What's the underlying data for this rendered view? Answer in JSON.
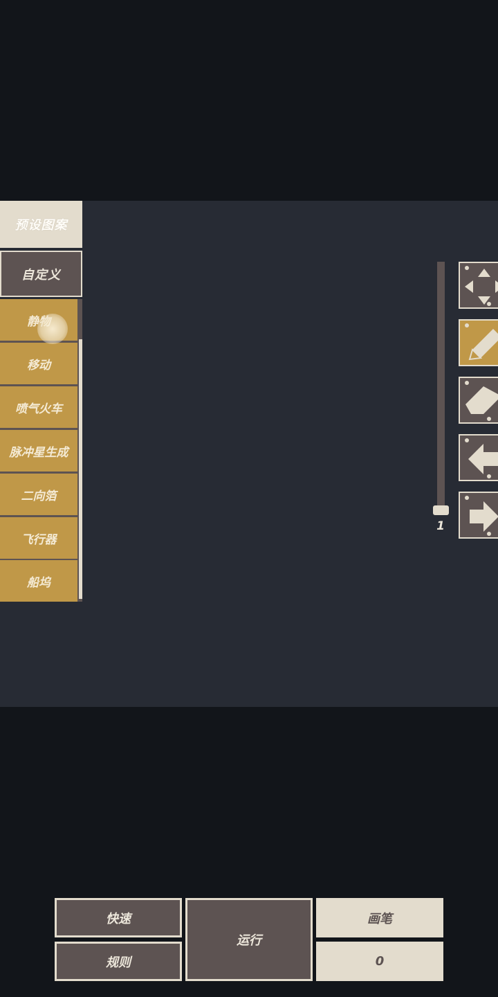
{
  "sidebar": {
    "preset_tab": "预设图案",
    "custom_tab": "自定义",
    "patterns": [
      "静物",
      "移动",
      "喷气火车",
      "脉冲星生成",
      "二向箔",
      "飞行器",
      "船坞"
    ]
  },
  "brush_slider": {
    "value": "1"
  },
  "toolbar": {
    "tools": [
      {
        "icon": "move-arrows-icon",
        "active": false
      },
      {
        "icon": "pencil-icon",
        "active": true
      },
      {
        "icon": "eraser-icon",
        "active": false
      },
      {
        "icon": "arrow-left-icon",
        "active": false
      },
      {
        "icon": "arrow-right-icon",
        "active": false
      }
    ]
  },
  "bottom_bar": {
    "fast_label": "快速",
    "rules_label": "规则",
    "run_label": "运行",
    "brush_label": "画笔",
    "count_value": "0"
  },
  "colors": {
    "background": "#12151a",
    "canvas": "#272b34",
    "panel": "#5d5352",
    "light": "#e3dccd",
    "accent": "#c09848"
  }
}
